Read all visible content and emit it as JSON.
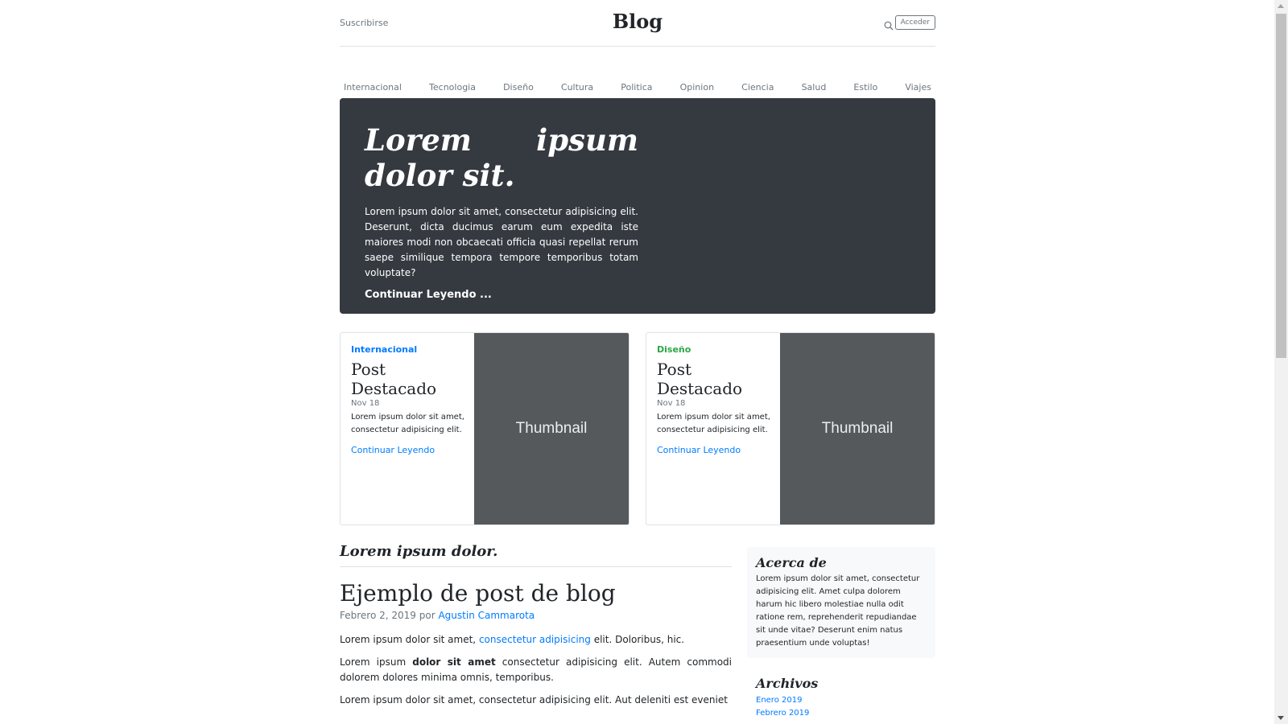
{
  "header": {
    "subscribe": "Suscribirse",
    "brand": "Blog",
    "search_icon": "search-icon",
    "login": "Acceder"
  },
  "nav": [
    "Internacional",
    "Tecnologia",
    "Diseño",
    "Cultura",
    "Politica",
    "Opinion",
    "Ciencia",
    "Salud",
    "Estilo",
    "Viajes"
  ],
  "jumbotron": {
    "title": "Lorem ipsum dolor sit.",
    "lead": "Lorem ipsum dolor sit amet, consectetur adipisicing elit. Deserunt, dicta ducimus earum eum expedita iste maiores modi non obcaecati officia quasi repellat rerum saepe similique tempora tempore temporibus totam voluptate?",
    "link": "Continuar Leyendo ..."
  },
  "cards": [
    {
      "category": "Internacional",
      "category_color": "#007bff",
      "title": "Post Destacado",
      "date": "Nov 18",
      "text": "Lorem ipsum dolor sit amet, consectetur adipisicing elit.",
      "link": "Continuar Leyendo",
      "thumb": "Thumbnail"
    },
    {
      "category": "Diseño",
      "category_color": "#28a745",
      "title": "Post Destacado",
      "date": "Nov 18",
      "text": "Lorem ipsum dolor sit amet, consectetur adipisicing elit.",
      "link": "Continuar Leyendo",
      "thumb": "Thumbnail"
    }
  ],
  "main": {
    "section_title": "Lorem ipsum dolor.",
    "post": {
      "title": "Ejemplo de post de blog",
      "meta_date": "Febrero 2, 2019 por",
      "author": "Agustin Cammarota",
      "p1_start": "Lorem ipsum dolor sit amet,",
      "p1_link": "consectetur adipisicing",
      "p1_end": "elit. Doloribus, hic.",
      "p2_start": "Lorem ipsum",
      "p2_strong": "dolor sit amet",
      "p2_end": "consectetur adipisicing elit. Autem commodi dolorem dolores minima omnis, temporibus.",
      "p3": "Lorem ipsum dolor sit amet, consectetur adipisicing elit. Aut deleniti est eveniet"
    }
  },
  "sidebar": {
    "about_title": "Acerca de",
    "about_text": "Lorem ipsum dolor sit amet, consectetur adipisicing elit. Amet culpa dolorem harum hic libero molestiae nulla odit ratione rem, reprehenderit repudiandae sit unde vitae? Deserunt enim natus praesentium unde voluptas!",
    "archives_title": "Archivos",
    "archives": [
      "Enero 2019",
      "Febrero 2019"
    ]
  }
}
